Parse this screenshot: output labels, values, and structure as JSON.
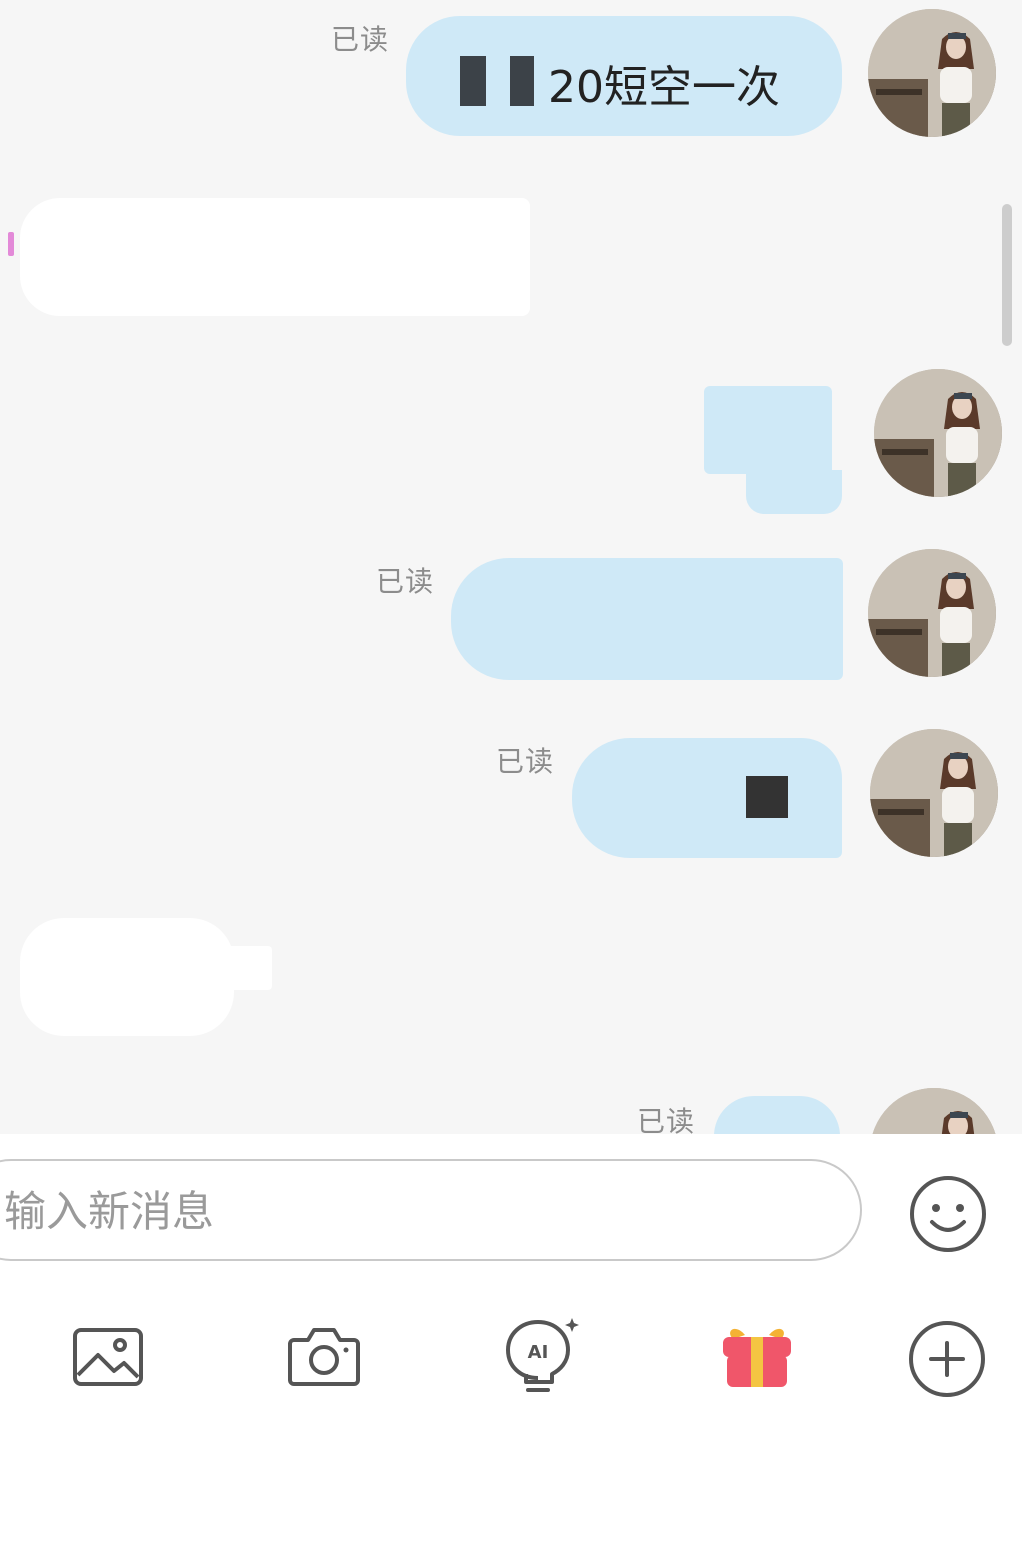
{
  "chat": {
    "read_label": "已读",
    "messages": [
      {
        "side": "out",
        "read": true,
        "text": "20短空一次"
      },
      {
        "side": "in",
        "read": false,
        "text": ""
      },
      {
        "side": "out",
        "read": false,
        "text": ""
      },
      {
        "side": "out",
        "read": true,
        "text": ""
      },
      {
        "side": "out",
        "read": true,
        "text": ""
      },
      {
        "side": "in",
        "read": false,
        "text": ""
      },
      {
        "side": "out",
        "read": true,
        "text": ""
      }
    ]
  },
  "composer": {
    "placeholder": "输入新消息",
    "emoji_icon": "smiley-icon",
    "toolbar": [
      {
        "name": "image-icon"
      },
      {
        "name": "camera-icon"
      },
      {
        "name": "ai-bulb-icon"
      },
      {
        "name": "gift-icon"
      },
      {
        "name": "plus-icon"
      }
    ]
  },
  "colors": {
    "outgoing_bubble": "#cfe9f7",
    "incoming_bubble": "#ffffff",
    "background": "#f6f6f6",
    "gift_accent": "#f0566a"
  }
}
